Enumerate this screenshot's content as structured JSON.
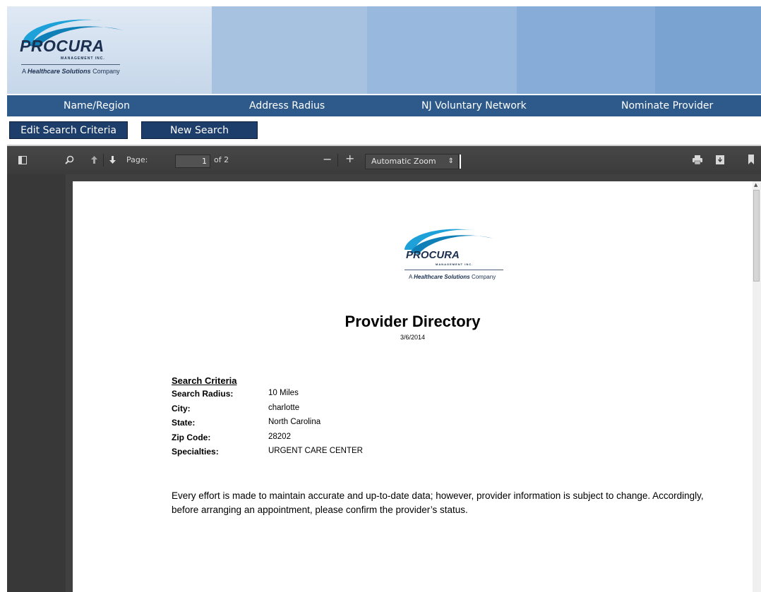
{
  "header": {
    "logo_word": "PROCURA",
    "logo_sub": "MANAGEMENT INC.",
    "logo_tag_bold": "Healthcare Solutions",
    "logo_tag_prefix": "A",
    "logo_tag_suffix": "Company"
  },
  "nav": {
    "items": [
      {
        "label": "Name/Region"
      },
      {
        "label": "Address Radius"
      },
      {
        "label": "NJ Voluntary Network"
      },
      {
        "label": "Nominate Provider"
      }
    ]
  },
  "actions": {
    "edit_label": "Edit Search Criteria",
    "new_label": "New Search"
  },
  "viewer": {
    "page_label": "Page:",
    "page_number": "1",
    "page_total": "of 2",
    "zoom_label": "Automatic Zoom",
    "minus": "−",
    "plus": "+"
  },
  "document": {
    "title": "Provider Directory",
    "date": "3/6/2014",
    "criteria_heading": "Search Criteria",
    "criteria": [
      {
        "key": "Search Radius:",
        "value": "10 Miles"
      },
      {
        "key": "City:",
        "value": "charlotte"
      },
      {
        "key": "State:",
        "value": "North Carolina"
      },
      {
        "key": "Zip Code:",
        "value": "28202"
      },
      {
        "key": "Specialties:",
        "value": "URGENT CARE CENTER"
      }
    ],
    "disclaimer": "Every effort is made to maintain accurate and up-to-date data; however, provider information is subject to change.  Accordingly, before arranging an appointment, please confirm the provider’s status."
  },
  "colors": {
    "nav_bg": "#2d5a8b",
    "button_bg": "#1d3d6a",
    "viewer_bg": "#404040"
  }
}
